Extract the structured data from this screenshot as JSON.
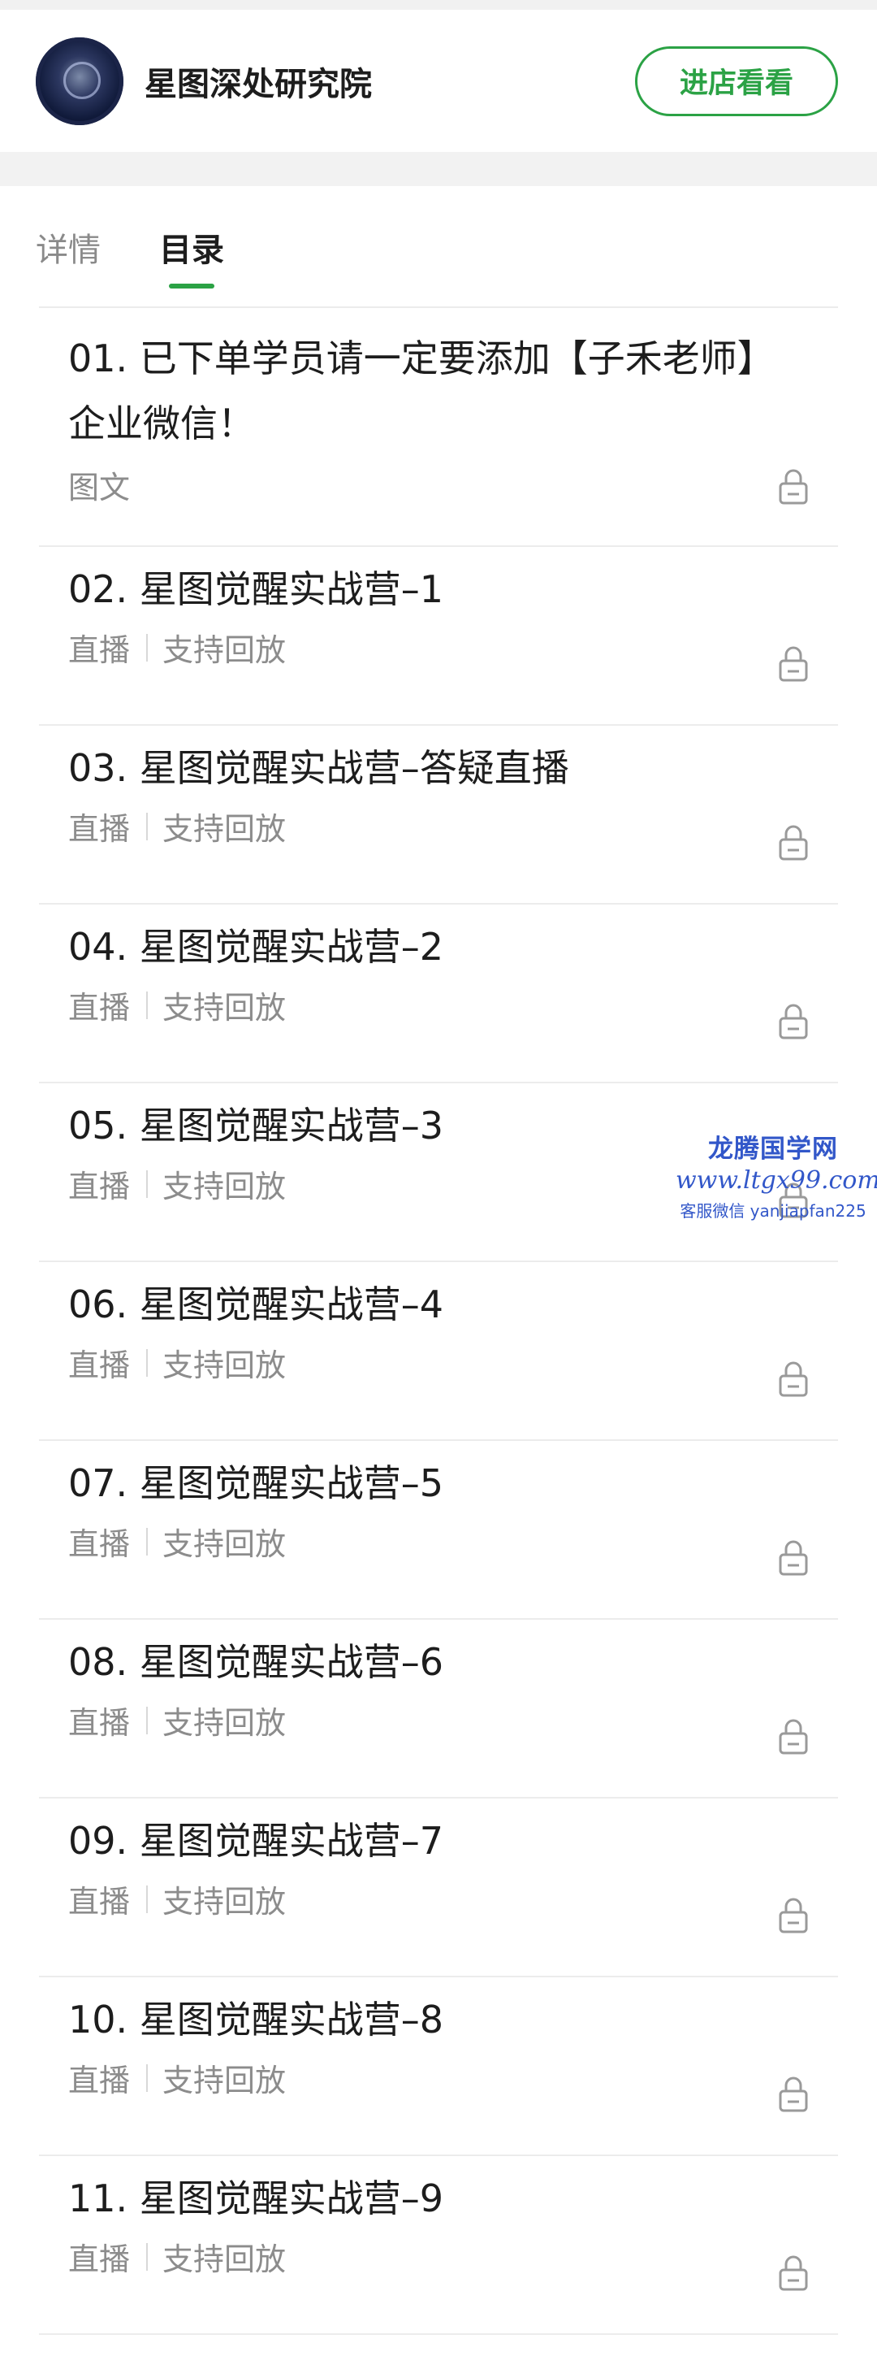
{
  "shop": {
    "name": "星图深处研究院",
    "enter_button": "进店看看"
  },
  "tabs": [
    {
      "label": "详情",
      "active": false
    },
    {
      "label": "目录",
      "active": true
    }
  ],
  "items": [
    {
      "title": "01. 已下单学员请一定要添加【子禾老师】企业微信！",
      "type": "图文",
      "extra": ""
    },
    {
      "title": "02. 星图觉醒实战营–1",
      "type": "直播",
      "extra": "支持回放"
    },
    {
      "title": "03. 星图觉醒实战营–答疑直播",
      "type": "直播",
      "extra": "支持回放"
    },
    {
      "title": "04. 星图觉醒实战营–2",
      "type": "直播",
      "extra": "支持回放"
    },
    {
      "title": "05. 星图觉醒实战营–3",
      "type": "直播",
      "extra": "支持回放"
    },
    {
      "title": "06. 星图觉醒实战营–4",
      "type": "直播",
      "extra": "支持回放"
    },
    {
      "title": "07. 星图觉醒实战营–5",
      "type": "直播",
      "extra": "支持回放"
    },
    {
      "title": "08. 星图觉醒实战营–6",
      "type": "直播",
      "extra": "支持回放"
    },
    {
      "title": "09. 星图觉醒实战营–7",
      "type": "直播",
      "extra": "支持回放"
    },
    {
      "title": "10. 星图觉醒实战营–8",
      "type": "直播",
      "extra": "支持回放"
    },
    {
      "title": "11. 星图觉醒实战营–9",
      "type": "直播",
      "extra": "支持回放"
    }
  ],
  "icons": {
    "lock": "lock-icon",
    "avatar": "shop-avatar"
  },
  "colors": {
    "accent": "#2ba245",
    "watermark": "#3257c9"
  },
  "watermark": {
    "line1": "龙腾国学网",
    "line2": "www.ltgx99.com",
    "line3": "客服微信 yanjiapfan225"
  }
}
